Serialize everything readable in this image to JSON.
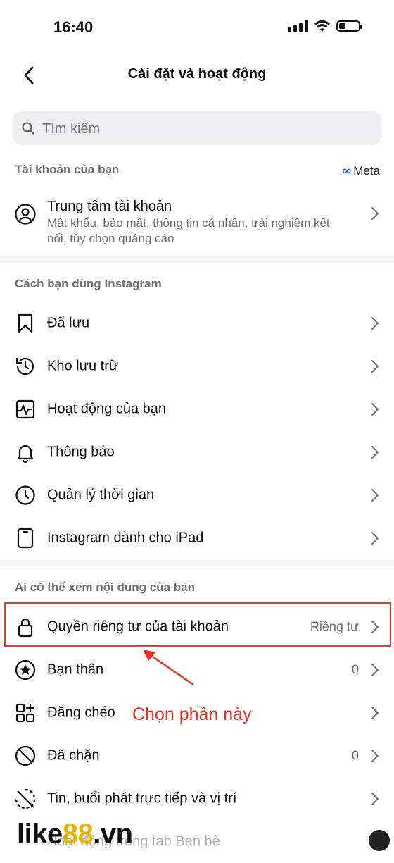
{
  "status": {
    "time": "16:40"
  },
  "header": {
    "title": "Cài đặt và hoạt động"
  },
  "search": {
    "placeholder": "Tìm kiếm"
  },
  "sections": {
    "account": "Tài khoản của bạn",
    "meta_logo": "Meta",
    "usage": "Cách bạn dùng Instagram",
    "visibility": "Ai có thể xem nội dung của bạn"
  },
  "account_center": {
    "title": "Trung tâm tài khoản",
    "subtitle": "Mật khẩu, bảo mật, thông tin cá nhân, trải nghiệm kết nối, tùy chọn quảng cáo"
  },
  "usage_items": [
    {
      "label": "Đã lưu",
      "icon": "bookmark-icon"
    },
    {
      "label": "Kho lưu trữ",
      "icon": "archive-clock-icon"
    },
    {
      "label": "Hoạt động của bạn",
      "icon": "activity-icon"
    },
    {
      "label": "Thông báo",
      "icon": "bell-icon"
    },
    {
      "label": "Quản lý thời gian",
      "icon": "clock-icon"
    },
    {
      "label": "Instagram dành cho iPad",
      "icon": "tablet-icon"
    }
  ],
  "visibility_items": [
    {
      "label": "Quyền riêng tư của tài khoản",
      "value": "Riêng tư",
      "icon": "lock-icon"
    },
    {
      "label": "Bạn thân",
      "value": "0",
      "icon": "star-icon"
    },
    {
      "label": "Đăng chéo",
      "value": "",
      "icon": "crosspost-icon"
    },
    {
      "label": "Đã chặn",
      "value": "0",
      "icon": "block-icon"
    },
    {
      "label": "Tin, buổi phát trực tiếp và vị trí",
      "value": "",
      "icon": "story-off-icon"
    },
    {
      "label": "Hoạt động trong tab Bạn bè",
      "value": "",
      "icon": "friends-icon"
    }
  ],
  "annotation": {
    "text": "Chọn phần này"
  },
  "watermark": {
    "part1": "like",
    "part2": "88",
    "part3": ".vn"
  }
}
